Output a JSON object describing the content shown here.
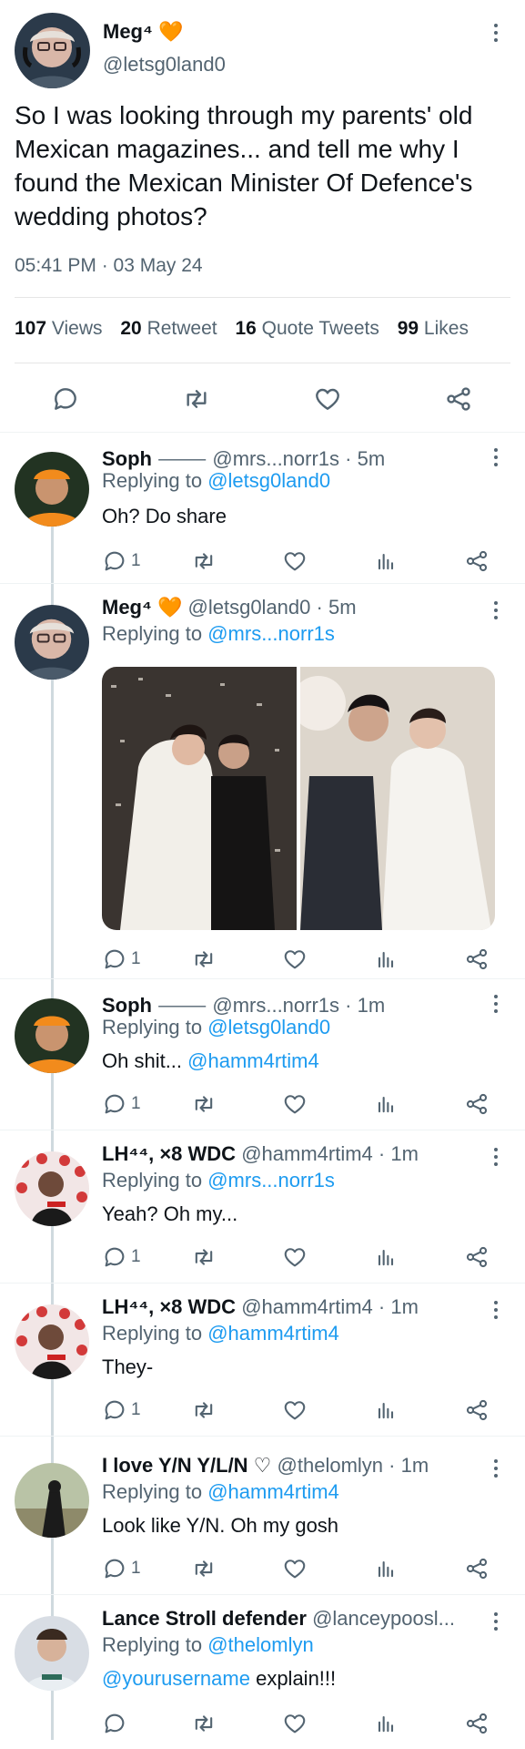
{
  "main_tweet": {
    "name": "Meg⁴ 🧡",
    "handle": "@letsg0land0",
    "text": "So I was looking through my parents' old Mexican magazines... and tell me why I found the Mexican Minister Of Defence's wedding photos?",
    "timestamp": "05:41 PM · 03 May 24",
    "stats": {
      "views_count": "107",
      "views_label": "Views",
      "retweets_count": "20",
      "retweets_label": "Retweet",
      "quotes_count": "16",
      "quotes_label": "Quote Tweets",
      "likes_count": "99",
      "likes_label": "Likes"
    }
  },
  "replies": [
    {
      "name": "Soph",
      "handle": "@mrs...norr1s",
      "time": "· 5m",
      "replying_prefix": "Replying to",
      "replying_to": "@letsg0land0",
      "text": "Oh? Do share",
      "reply_count": "1"
    },
    {
      "name": "Meg⁴ 🧡",
      "handle": "@letsg0land0",
      "time": "· 5m",
      "replying_prefix": "Replying to",
      "replying_to": "@mrs...norr1s",
      "reply_count": "1"
    },
    {
      "name": "Soph",
      "handle": "@mrs...norr1s",
      "time": "· 1m",
      "replying_prefix": "Replying to",
      "replying_to": "@letsg0land0",
      "text": "Oh shit... ",
      "text_mention": "@hamm4rtim4",
      "reply_count": "1"
    },
    {
      "name": "LH⁴⁴, ×8 WDC",
      "handle": "@hamm4rtim4",
      "time": "· 1m",
      "replying_prefix": "Replying to",
      "replying_to": "@mrs...norr1s",
      "text": "Yeah? Oh my...",
      "reply_count": "1"
    },
    {
      "name": "LH⁴⁴, ×8 WDC",
      "handle": "@hamm4rtim4",
      "time": "· 1m",
      "replying_prefix": "Replying to",
      "replying_to": "@hamm4rtim4",
      "text": "They-",
      "reply_count": "1"
    },
    {
      "name": "I love Y/N Y/L/N ♡",
      "handle": "@thelomlyn",
      "time": "· 1m",
      "replying_prefix": "Replying to",
      "replying_to": "@hamm4rtim4",
      "text": "Look like Y/N. Oh my gosh",
      "reply_count": "1"
    },
    {
      "name": "Lance Stroll defender",
      "handle": "@lanceypoosl...",
      "time": "",
      "replying_prefix": "Replying to",
      "replying_to": "@thelomlyn",
      "text_mention": "@yourusername",
      "text": " explain!!!",
      "reply_count": ""
    }
  ],
  "icons": [
    "reply-icon",
    "retweet-icon",
    "like-icon",
    "share-icon",
    "views-icon",
    "more-icon"
  ],
  "colors": {
    "link": "#1d9bf0",
    "muted": "#536471",
    "text": "#0f1419",
    "accent_heart": "#f4a11a"
  }
}
